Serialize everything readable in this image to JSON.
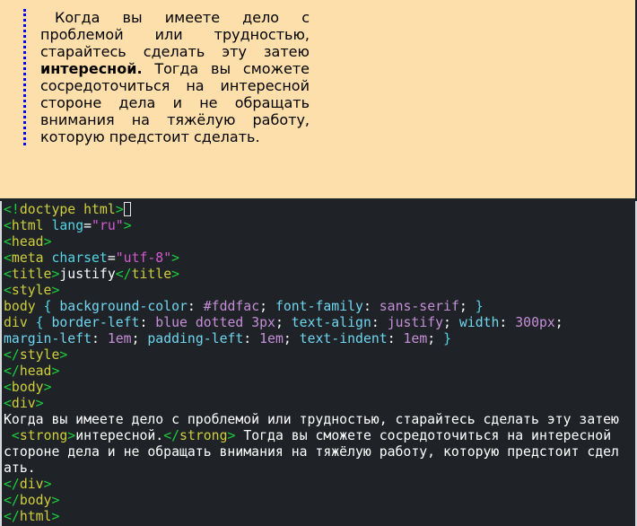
{
  "preview": {
    "paragraph_before": "Когда вы имеете дело с проблемой или трудностью, старайтесь сделать эту затею ",
    "paragraph_strong": "интересной.",
    "paragraph_after": " Тогда вы сможете сосредоточиться на интересной стороне дела и не обращать внимания на тяжёлую работу, которую предстоит сделать.",
    "colors": {
      "background": "#fddfac",
      "border": "#0000ff"
    }
  },
  "editor": {
    "lines": [
      "<!doctype html>",
      "<html lang=\"ru\">",
      "<head>",
      "<meta charset=\"utf-8\">",
      "<title>justify</title>",
      "<style>",
      "body { background-color: #fddfac; font-family: sans-serif; }",
      "div { border-left: blue dotted 3px; text-align: justify; width: 300px;",
      "margin-left: 1em; padding-left: 1em; text-indent: 1em; }",
      "</style>",
      "</head>",
      "<body>",
      "<div>",
      "Когда вы имеете дело с проблемой или трудностью, старайтесь сделать эту затею",
      " <strong>интересной.</strong> Тогда вы сможете сосредоточиться на интересной",
      "стороне дела и не обращать внимания на тяжёлую работу, которую предстоит сдел",
      "ать.",
      "</div>",
      "</body>",
      "</html>"
    ]
  }
}
